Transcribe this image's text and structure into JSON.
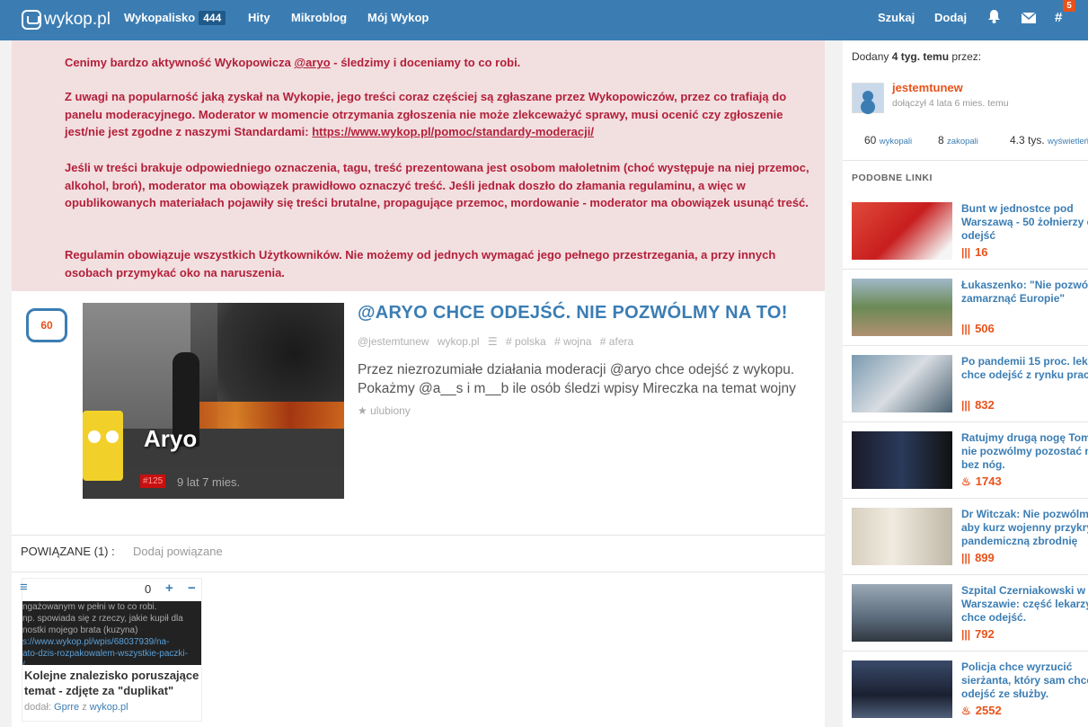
{
  "nav": {
    "logo": "wykop.pl",
    "items": [
      {
        "label": "Wykopalisko",
        "badge": "444"
      },
      {
        "label": "Hity"
      },
      {
        "label": "Mikroblog"
      },
      {
        "label": "Mój Wykop"
      }
    ],
    "search": "Szukaj",
    "add": "Dodaj",
    "notifications_count": "5"
  },
  "warning": {
    "p1_pre": "Cenimy bardzo aktywność Wykopowicza ",
    "p1_mention": "@aryo",
    "p1_post": " - śledzimy i doceniamy to co robi.",
    "p2_pre": "Z uwagi na popularność jaką zyskał na Wykopie, jego treści coraz częściej są zgłaszane przez Wykopowiczów, przez co trafiają do panelu moderacyjnego. Moderator w momencie otrzymania zgłoszenia nie może zlekceważyć sprawy, musi ocenić czy zgłoszenie jest/nie jest zgodne z naszymi Standardami: ",
    "p2_link": "https://www.wykop.pl/pomoc/standardy-moderacji/",
    "p3": "Jeśli w treści brakuje odpowiedniego oznaczenia, tagu, treść prezentowana jest osobom małoletnim (choć występuje na niej przemoc, alkohol, broń), moderator ma obowiązek prawidłowo oznaczyć treść. Jeśli jednak doszło do złamania regulaminu, a więc w opublikowanych materiałach pojawiły się treści brutalne, propagujące przemoc, mordowanie - moderator ma obowiązek usunąć treść.",
    "p4": "Regulamin obowiązuje wszystkich Użytkowników. Nie możemy od jednych wymagać jego pełnego przestrzegania, a przy innych osobach przymykać oko na naruszenia."
  },
  "post": {
    "votes": "60",
    "title": "@ARYO CHCE ODEJŚĆ. NIE POZWÓLMY NA TO!",
    "author": "@jestemtunew",
    "source": "wykop.pl",
    "tags": [
      "# polska",
      "# wojna",
      "# afera"
    ],
    "description": "Przez niezrozumiałe działania moderacji @aryo chce odejść z wykopu. Pokażmy @a__s i m__b ile osób śledzi wpisy Mireczka na temat wojny",
    "favorite": "ulubiony",
    "thumb_name": "Aryo",
    "thumb_rank": "#125",
    "thumb_age": "9 lat 7 mies."
  },
  "related": {
    "label": "POWIĄZANE (1) :",
    "add_label": "Dodaj powiązane",
    "count": "0",
    "plus": "+",
    "minus": "−",
    "card": {
      "img_lines": [
        "ngażowanym w pełni w to co robi.",
        "np. spowiada się z rzeczy, jakie kupił dla",
        "nostki mojego brata (kuzyna)",
        "s://www.wykop.pl/wpis/68037939/na-",
        "ato-dzis-rozpakowalem-wszystkie-paczki-",
        "/"
      ],
      "title": "Kolejne znalezisko poruszające temat - zdjęte za \"duplikat\"",
      "by_label": "dodał:",
      "by_user": "Gprre",
      "by_mid": "z",
      "by_source": "wykop.pl"
    }
  },
  "sidebar": {
    "added_pre": "Dodany ",
    "added_bold": "4 tyg. temu",
    "added_post": " przez:",
    "username": "jestemtunew",
    "joined": "dołączył 4 lata 6 mies. temu",
    "stats": [
      {
        "value": "60",
        "label": "wykopali"
      },
      {
        "value": "8",
        "label": "zakopali"
      },
      {
        "value": "4.3 tys.",
        "label": "wyświetleń"
      }
    ],
    "similar_heading": "PODOBNE LINKI",
    "similar": [
      {
        "title_lines": [
          "Bunt w jednostce pod",
          "Warszawą - 50 żołnierzy c",
          "odejść"
        ],
        "count": "16",
        "icon": "flame-icon"
      },
      {
        "title_lines": [
          "Łukaszenko: \"Nie pozwól",
          "zamarznąć Europie\""
        ],
        "count": "506",
        "icon": "flame-icon"
      },
      {
        "title_lines": [
          "Po pandemii 15 proc. leka",
          "chce odejść z rynku pracy"
        ],
        "count": "832",
        "icon": "flame-icon"
      },
      {
        "title_lines": [
          "Ratujmy drugą nogę Tom",
          "nie pozwólmy pozostać n",
          "bez nóg."
        ],
        "count": "1743",
        "icon": "hot-icon"
      },
      {
        "title_lines": [
          "Dr Witczak: Nie pozwólm",
          "aby kurz wojenny przykry",
          "pandemiczną zbrodnię"
        ],
        "count": "899",
        "icon": "flame-icon"
      },
      {
        "title_lines": [
          "Szpital Czerniakowski w",
          "Warszawie: część lekarzy",
          "chce odejść."
        ],
        "count": "792",
        "icon": "flame-icon"
      },
      {
        "title_lines": [
          "Policja chce wyrzucić",
          "sierżanta, który sam chce",
          "odejść ze służby."
        ],
        "count": "2552",
        "icon": "hot-icon"
      }
    ]
  },
  "colors": {
    "brand": "#3b7db3",
    "accent": "#e8521a",
    "warning_text": "#b3203a",
    "warning_bg": "#f2dfe0"
  }
}
